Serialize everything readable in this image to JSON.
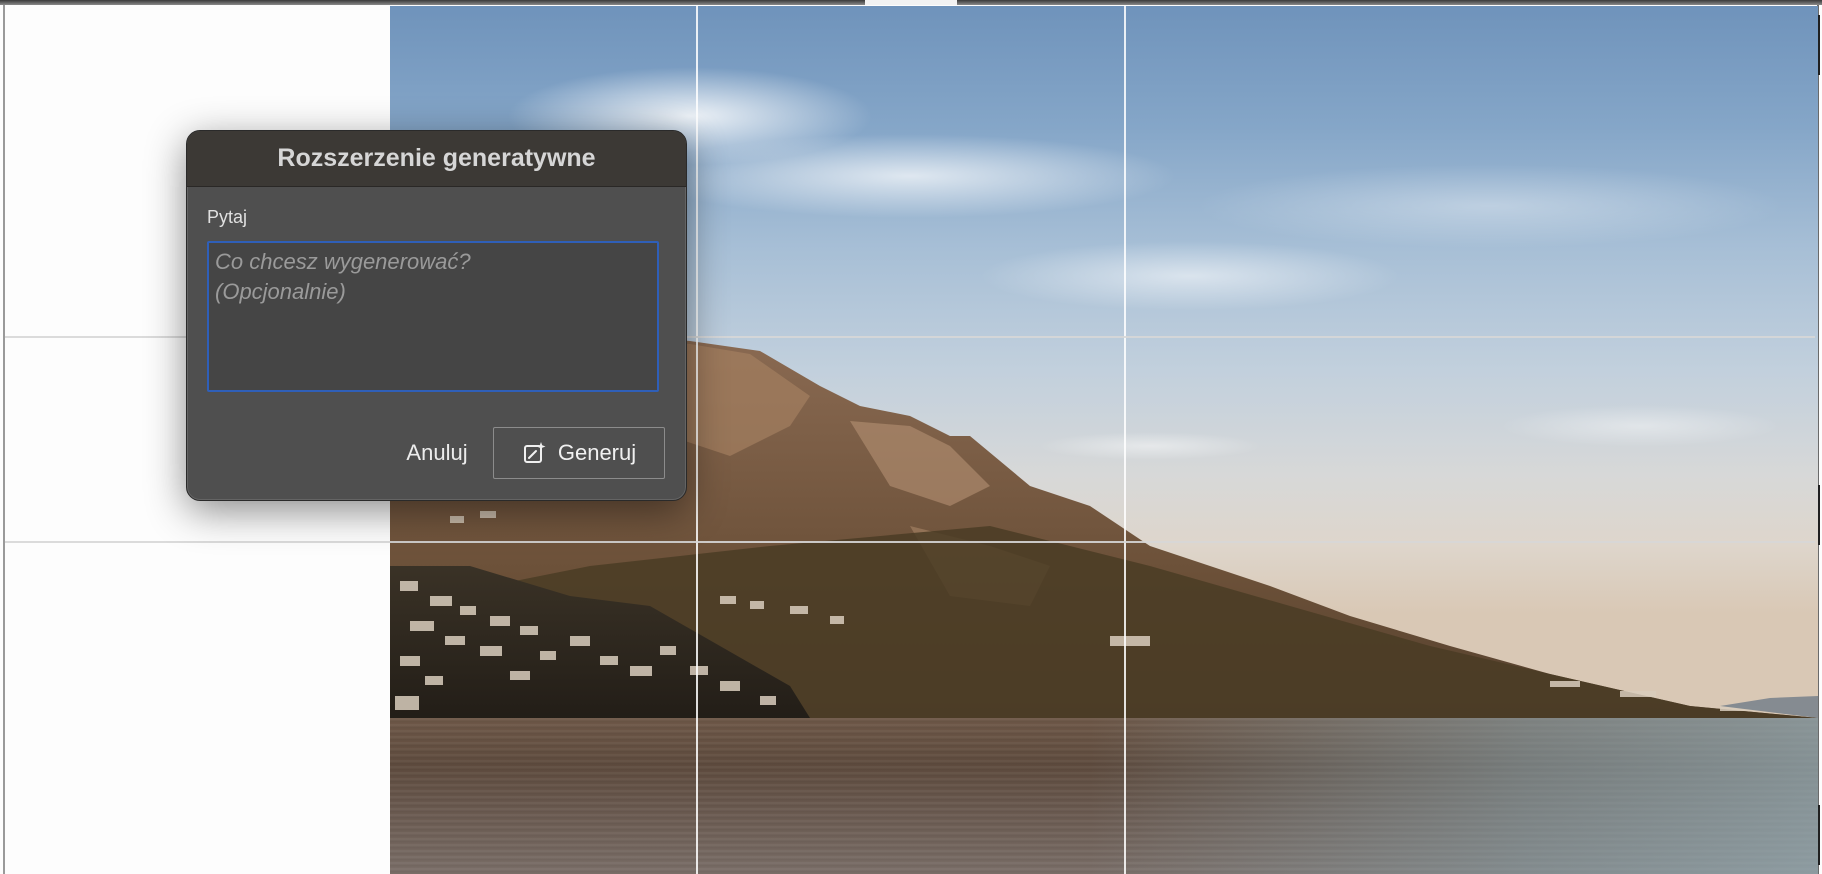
{
  "dialog": {
    "title": "Rozszerzenie generatywne",
    "prompt_label": "Pytaj",
    "prompt_value": "",
    "prompt_placeholder": "Co chcesz wygenerować?\n(Opcjonalnie)",
    "cancel_label": "Anuluj",
    "generate_label": "Generuj",
    "generate_icon": "generative-fill-icon"
  },
  "colors": {
    "dialog_bg": "#4f4f4f",
    "title_bar": "#3c3935",
    "input_focus": "#2f5fb8"
  }
}
